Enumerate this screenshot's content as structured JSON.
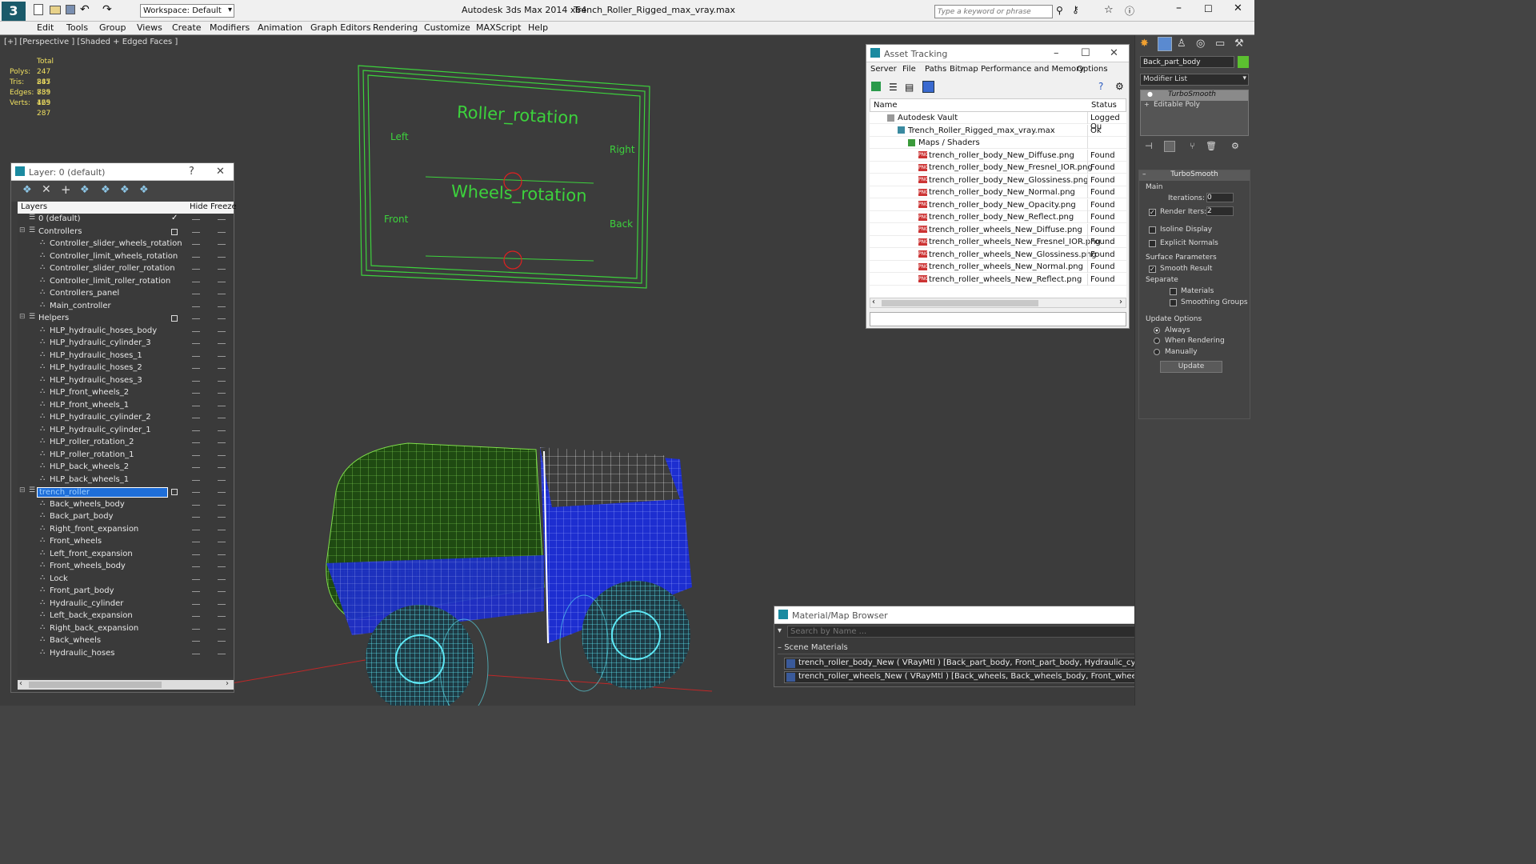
{
  "titlebar": {
    "app_title": "Autodesk 3ds Max  2014 x64",
    "file_title": "Trench_Roller_Rigged_max_vray.max",
    "workspace": "Workspace: Default",
    "search_placeholder": "Type a keyword or phrase"
  },
  "menu": [
    "Edit",
    "Tools",
    "Group",
    "Views",
    "Create",
    "Modifiers",
    "Animation",
    "Graph Editors",
    "Rendering",
    "Customize",
    "MAXScript",
    "Help"
  ],
  "viewport": {
    "label": "[+] [Perspective ] [Shaded + Edged Faces ]",
    "stats": {
      "header": "Total",
      "rows": [
        {
          "k": "Polys:",
          "v": "247 885"
        },
        {
          "k": "Tris:",
          "v": "247 885"
        },
        {
          "k": "Edges:",
          "v": "739 465"
        },
        {
          "k": "Verts:",
          "v": "129 287"
        }
      ]
    },
    "controls": {
      "roller_title": "Roller_rotation",
      "left": "Left",
      "right": "Right",
      "wheels_title": "Wheels_rotation",
      "front": "Front",
      "back": "Back"
    }
  },
  "layer_window": {
    "title": "Layer: 0 (default)",
    "help": "?",
    "columns": [
      "Layers",
      "Hide",
      "Freeze"
    ],
    "rows": [
      {
        "name": "0 (default)",
        "level": 0,
        "check": true
      },
      {
        "name": "Controllers",
        "level": 0,
        "box": true,
        "group": true
      },
      {
        "name": "Controller_slider_wheels_rotation",
        "level": 1
      },
      {
        "name": "Controller_limit_wheels_rotation",
        "level": 1
      },
      {
        "name": "Controller_slider_roller_rotation",
        "level": 1
      },
      {
        "name": "Controller_limit_roller_rotation",
        "level": 1
      },
      {
        "name": "Controllers_panel",
        "level": 1
      },
      {
        "name": "Main_controller",
        "level": 1
      },
      {
        "name": "Helpers",
        "level": 0,
        "box": true,
        "group": true
      },
      {
        "name": "HLP_hydraulic_hoses_body",
        "level": 1
      },
      {
        "name": "HLP_hydraulic_cylinder_3",
        "level": 1
      },
      {
        "name": "HLP_hydraulic_hoses_1",
        "level": 1
      },
      {
        "name": "HLP_hydraulic_hoses_2",
        "level": 1
      },
      {
        "name": "HLP_hydraulic_hoses_3",
        "level": 1
      },
      {
        "name": "HLP_front_wheels_2",
        "level": 1
      },
      {
        "name": "HLP_front_wheels_1",
        "level": 1
      },
      {
        "name": "HLP_hydraulic_cylinder_2",
        "level": 1
      },
      {
        "name": "HLP_hydraulic_cylinder_1",
        "level": 1
      },
      {
        "name": "HLP_roller_rotation_2",
        "level": 1
      },
      {
        "name": "HLP_roller_rotation_1",
        "level": 1
      },
      {
        "name": "HLP_back_wheels_2",
        "level": 1
      },
      {
        "name": "HLP_back_wheels_1",
        "level": 1
      },
      {
        "name": "trench_roller",
        "level": 0,
        "box": true,
        "group": true,
        "selected": true
      },
      {
        "name": "Back_wheels_body",
        "level": 1
      },
      {
        "name": "Back_part_body",
        "level": 1
      },
      {
        "name": "Right_front_expansion",
        "level": 1
      },
      {
        "name": "Front_wheels",
        "level": 1
      },
      {
        "name": "Left_front_expansion",
        "level": 1
      },
      {
        "name": "Front_wheels_body",
        "level": 1
      },
      {
        "name": "Lock",
        "level": 1
      },
      {
        "name": "Front_part_body",
        "level": 1
      },
      {
        "name": "Hydraulic_cylinder",
        "level": 1
      },
      {
        "name": "Left_back_expansion",
        "level": 1
      },
      {
        "name": "Right_back_expansion",
        "level": 1
      },
      {
        "name": "Back_wheels",
        "level": 1
      },
      {
        "name": "Hydraulic_hoses",
        "level": 1
      }
    ]
  },
  "asset_tracking": {
    "title": "Asset Tracking",
    "menu": [
      "Server",
      "File",
      "Paths",
      "Bitmap Performance and Memory",
      "Options"
    ],
    "columns": [
      "Name",
      "Status"
    ],
    "rows": [
      {
        "name": "Autodesk Vault",
        "status": "Logged Ou",
        "indent": 0,
        "icon": "vault"
      },
      {
        "name": "Trench_Roller_Rigged_max_vray.max",
        "status": "Ok",
        "indent": 1,
        "icon": "max"
      },
      {
        "name": "Maps / Shaders",
        "status": "",
        "indent": 2,
        "icon": "maps"
      },
      {
        "name": "trench_roller_body_New_Diffuse.png",
        "status": "Found",
        "indent": 3,
        "icon": "png"
      },
      {
        "name": "trench_roller_body_New_Fresnel_IOR.png",
        "status": "Found",
        "indent": 3,
        "icon": "png"
      },
      {
        "name": "trench_roller_body_New_Glossiness.png",
        "status": "Found",
        "indent": 3,
        "icon": "png"
      },
      {
        "name": "trench_roller_body_New_Normal.png",
        "status": "Found",
        "indent": 3,
        "icon": "png"
      },
      {
        "name": "trench_roller_body_New_Opacity.png",
        "status": "Found",
        "indent": 3,
        "icon": "png"
      },
      {
        "name": "trench_roller_body_New_Reflect.png",
        "status": "Found",
        "indent": 3,
        "icon": "png"
      },
      {
        "name": "trench_roller_wheels_New_Diffuse.png",
        "status": "Found",
        "indent": 3,
        "icon": "png"
      },
      {
        "name": "trench_roller_wheels_New_Fresnel_IOR.png",
        "status": "Found",
        "indent": 3,
        "icon": "png"
      },
      {
        "name": "trench_roller_wheels_New_Glossiness.png",
        "status": "Found",
        "indent": 3,
        "icon": "png"
      },
      {
        "name": "trench_roller_wheels_New_Normal.png",
        "status": "Found",
        "indent": 3,
        "icon": "png"
      },
      {
        "name": "trench_roller_wheels_New_Reflect.png",
        "status": "Found",
        "indent": 3,
        "icon": "png"
      }
    ]
  },
  "material_browser": {
    "title": "Material/Map Browser",
    "search_placeholder": "Search by Name ...",
    "section": "Scene Materials",
    "items": [
      "trench_roller_body_New ( VRayMtl ) [Back_part_body, Front_part_body, Hydraulic_cylinder, Hydraulic_hoses, Lock]",
      "trench_roller_wheels_New ( VRayMtl ) [Back_wheels, Back_wheels_body, Front_wheels, Front_wheels_body, Left_back_expansi..."
    ]
  },
  "command_panel": {
    "object_name": "Back_part_body",
    "modifier_list": "Modifier List",
    "stack": [
      "TurboSmooth",
      "Editable Poly"
    ],
    "rollout_title": "TurboSmooth",
    "main_label": "Main",
    "iterations_label": "Iterations:",
    "iterations_value": "0",
    "render_iters_label": "Render Iters:",
    "render_iters_value": "2",
    "isoline": "Isoline Display",
    "explicit_normals": "Explicit Normals",
    "surface_params": "Surface Parameters",
    "smooth_result": "Smooth Result",
    "separate": "Separate",
    "materials": "Materials",
    "smoothing_groups": "Smoothing Groups",
    "update_options": "Update Options",
    "always": "Always",
    "when_rendering": "When Rendering",
    "manually": "Manually",
    "update_btn": "Update"
  }
}
